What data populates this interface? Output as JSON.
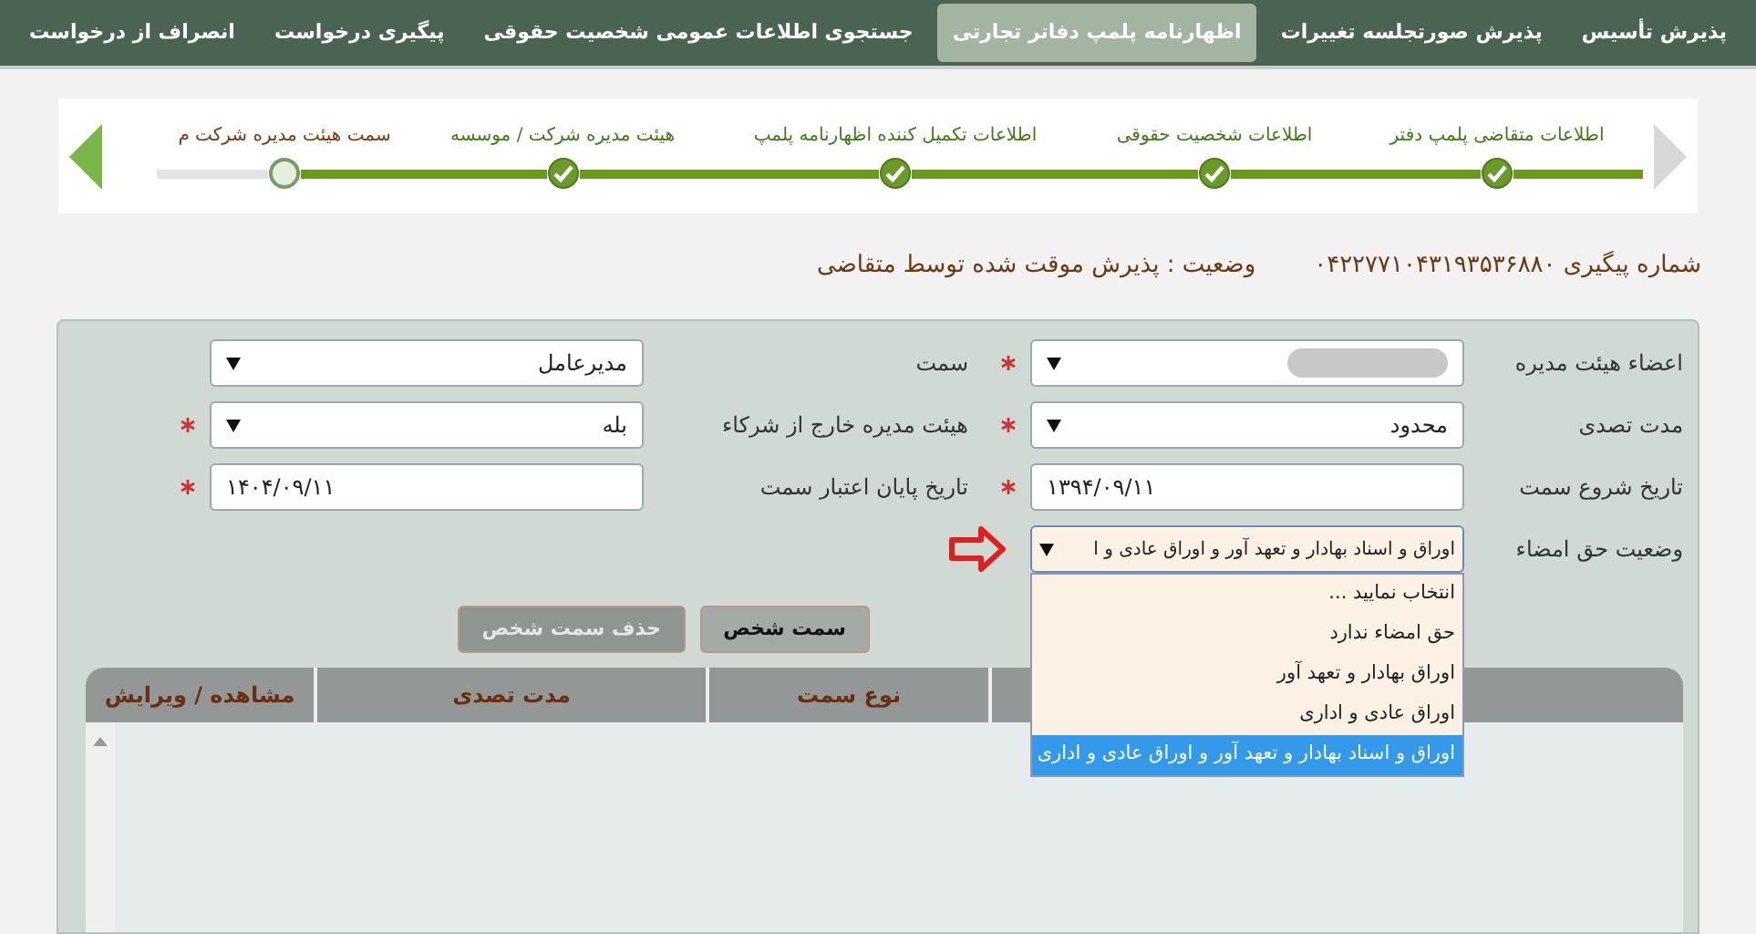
{
  "nav_tabs": [
    {
      "label": "پذیرش تأسیس",
      "selected": false
    },
    {
      "label": "پذیرش صورتجلسه تغییرات",
      "selected": false
    },
    {
      "label": "اظهارنامه پلمپ دفاتر تجارتی",
      "selected": true
    },
    {
      "label": "جستجوی اطلاعات عمومی شخصیت حقوقی",
      "selected": false
    },
    {
      "label": "پیگیری درخواست",
      "selected": false
    },
    {
      "label": "انصراف از درخواست",
      "selected": false
    }
  ],
  "stepper": {
    "back_disabled": true,
    "forward_disabled": false,
    "steps": [
      {
        "label": "اطلاعات متقاضی پلمپ دفتر",
        "done": true
      },
      {
        "label": "اطلاعات شخصیت حقوقی",
        "done": true
      },
      {
        "label": "اطلاعات تکمیل کننده اظهارنامه پلمپ",
        "done": true
      },
      {
        "label": "هیئت مدیره شرکت / موسسه",
        "done": true
      },
      {
        "label": "سمت هیئت مدیره شرکت م",
        "done": false
      }
    ]
  },
  "tracking": {
    "number": "شماره پیگیری ۰۴۲۲۷۷۱۰۴۳۱۹۳۵۳۶۸۸۰",
    "status": "وضعیت : پذیرش موقت شده توسط متقاضی"
  },
  "form": {
    "rows": [
      {
        "right": {
          "label": "اعضاء هیئت مدیره",
          "kind": "select",
          "value_redacted": true,
          "required": true
        },
        "left": {
          "label": "سمت",
          "kind": "select",
          "value": "مدیرعامل",
          "required": false
        }
      },
      {
        "right": {
          "label": "مدت تصدی",
          "kind": "select",
          "value": "محدود",
          "required": true
        },
        "left": {
          "label": "هیئت مدیره خارج از شرکاء",
          "kind": "select",
          "value": "بله",
          "required": true
        }
      },
      {
        "right": {
          "label": "تاریخ شروع سمت",
          "kind": "input",
          "value": "۱۳۹۴/۰۹/۱۱",
          "required": true
        },
        "left": {
          "label": "تاریخ پایان اعتبار سمت",
          "kind": "input",
          "value": "۱۴۰۴/۰۹/۱۱",
          "required": true
        }
      }
    ],
    "signature": {
      "label": "وضعیت حق امضاء",
      "value": "اوراق و اسناد بهادار و تعهد آور و اوراق عادی و ا",
      "expanded": true,
      "pointer_arrow": true,
      "options": [
        {
          "label": "انتخاب نمایید ...",
          "selected": false
        },
        {
          "label": "حق امضاء ندارد",
          "selected": false
        },
        {
          "label": "اوراق بهادار و تعهد آور",
          "selected": false
        },
        {
          "label": "اوراق عادی و اداری",
          "selected": false
        },
        {
          "label": "اوراق و اسناد بهادار و تعهد آور و اوراق عادی و اداری",
          "selected": true
        }
      ]
    }
  },
  "buttons": [
    {
      "label": "سمت شخص",
      "disabled": false
    },
    {
      "label": "حذف سمت شخص",
      "disabled": true
    }
  ],
  "table": {
    "columns": [
      "",
      "نوع سمت",
      "مدت تصدی",
      "مشاهده / ویرایش"
    ]
  }
}
